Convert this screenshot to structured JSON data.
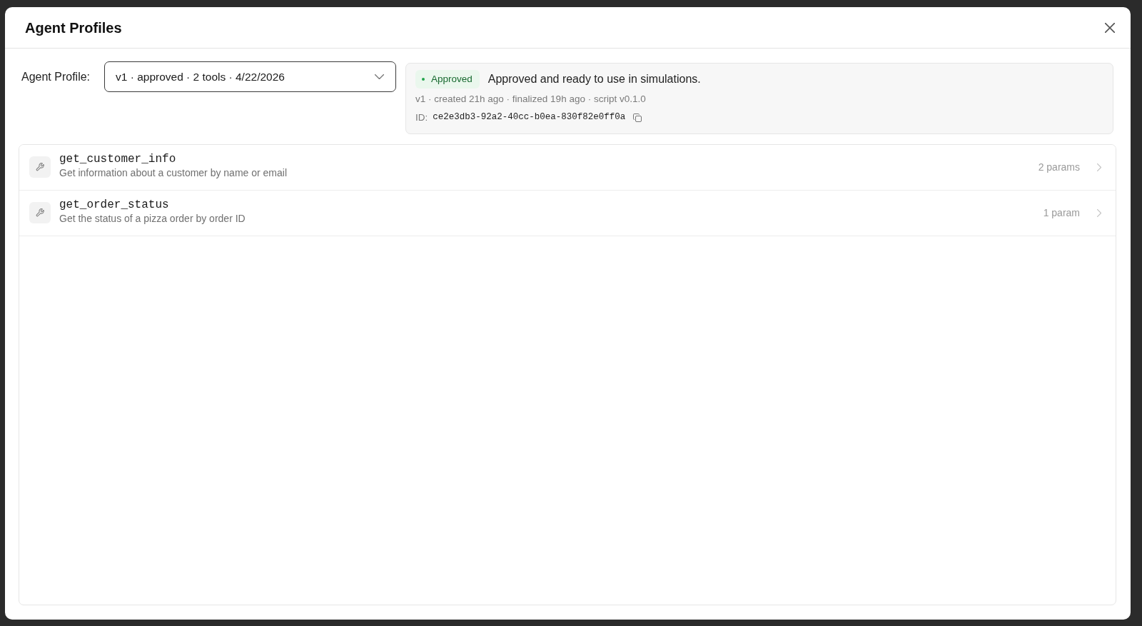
{
  "dialog": {
    "title": "Agent Profiles"
  },
  "profile": {
    "label": "Agent Profile:",
    "value": "v1 · approved · 2 tools · 4/22/2026"
  },
  "status": {
    "badge": "Approved",
    "message": "Approved and ready to use in simulations.",
    "meta": "v1 · created 21h ago · finalized 19h ago · script v0.1.0",
    "id_label": "ID:",
    "id": "ce2e3db3-92a2-40cc-b0ea-830f82e0ff0a"
  },
  "tools": [
    {
      "name": "get_customer_info",
      "description": "Get information about a customer by name or email",
      "params": "2 params"
    },
    {
      "name": "get_order_status",
      "description": "Get the status of a pizza order by order ID",
      "params": "1 param"
    }
  ]
}
